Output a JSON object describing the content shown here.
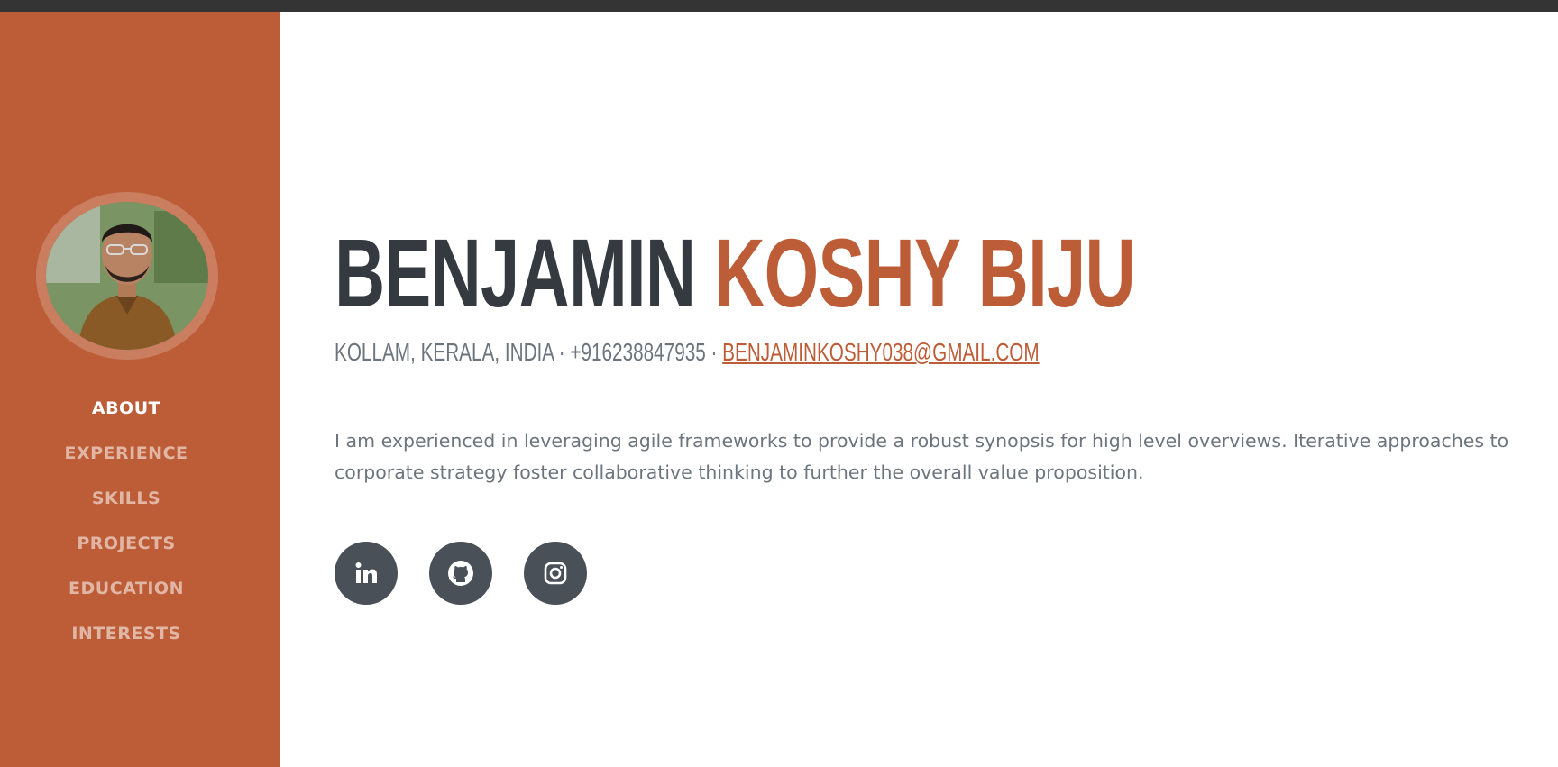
{
  "profile": {
    "first_name": "BENJAMIN",
    "last_name": "KOSHY BIJU",
    "location_phone": "KOLLAM, KERALA, INDIA · +916238847935 · ",
    "email": "BENJAMINKOSHY038@GMAIL.COM",
    "summary": "I am experienced in leveraging agile frameworks to provide a robust synopsis for high level overviews. Iterative approaches to corporate strategy foster collaborative thinking to further the overall value proposition."
  },
  "sidebar": {
    "avatar_icon": "profile-photo",
    "items": [
      {
        "label": "ABOUT",
        "active": true
      },
      {
        "label": "EXPERIENCE"
      },
      {
        "label": "SKILLS"
      },
      {
        "label": "PROJECTS"
      },
      {
        "label": "EDUCATION"
      },
      {
        "label": "INTERESTS"
      }
    ]
  },
  "social": [
    {
      "icon": "linkedin-icon"
    },
    {
      "icon": "github-icon"
    },
    {
      "icon": "instagram-icon"
    }
  ],
  "colors": {
    "primary": "#bd5d38",
    "dark": "#343a40",
    "muted": "#6c757d",
    "social_bg": "#495057",
    "topbar": "#343434"
  }
}
